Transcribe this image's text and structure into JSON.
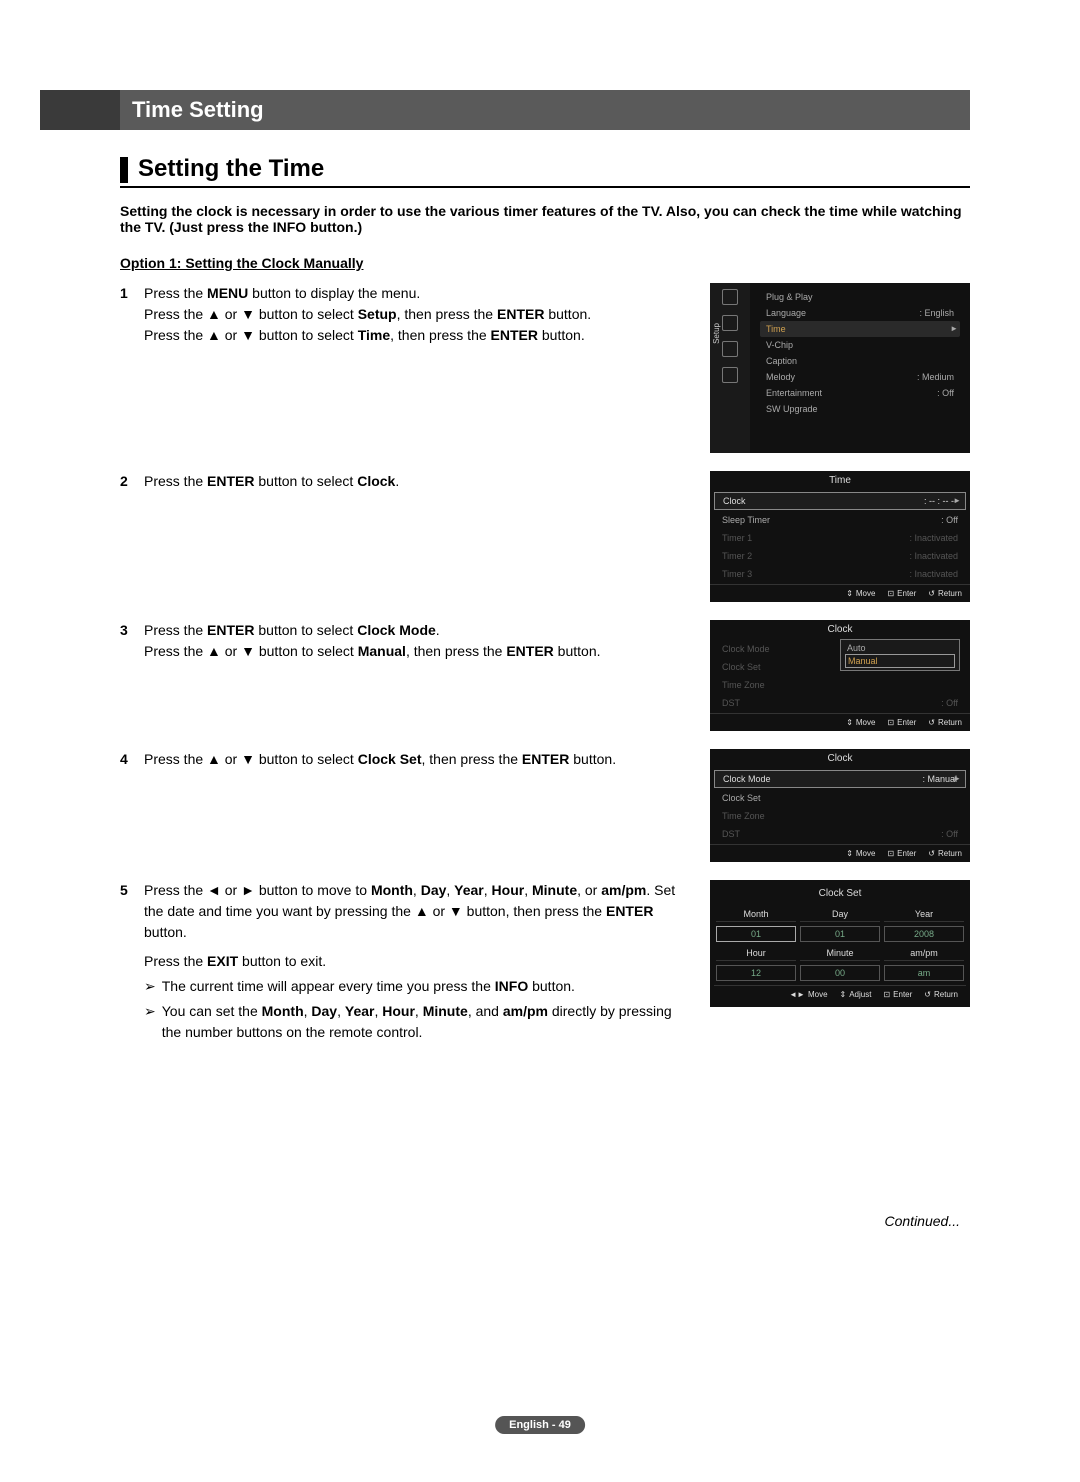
{
  "header": {
    "title": "Time Setting"
  },
  "title": "Setting the Time",
  "intro": "Setting the clock is necessary in order to use the various timer features of the TV. Also, you can check the time while watching the TV. (Just press the INFO button.)",
  "option_title": "Option 1: Setting the Clock Manually",
  "steps": [
    {
      "num": "1",
      "text": "Press the MENU button to display the menu.\nPress the ▲ or ▼ button to select Setup, then press the ENTER button.\nPress the ▲ or ▼ button to select Time, then press the ENTER button."
    },
    {
      "num": "2",
      "text": "Press the ENTER button to select Clock."
    },
    {
      "num": "3",
      "text": "Press the ENTER button to select Clock Mode.\nPress the ▲ or ▼ button to select Manual, then press the ENTER button."
    },
    {
      "num": "4",
      "text": "Press the ▲ or ▼ button to select Clock Set, then press the ENTER button."
    },
    {
      "num": "5",
      "text": "Press the ◄ or ► button to move to Month, Day, Year, Hour, Minute, or am/pm. Set the date and time you want by pressing the ▲ or ▼ button, then press the ENTER button.",
      "extra": "Press the EXIT button to exit.",
      "notes": [
        "The current time will appear every time you press the INFO button.",
        "You can set the Month, Day, Year, Hour, Minute, and am/pm directly by pressing the number buttons on the remote control."
      ]
    }
  ],
  "osd_setup": {
    "side_label": "Setup",
    "items": [
      {
        "label": "Plug & Play",
        "value": ""
      },
      {
        "label": "Language",
        "value": ": English"
      },
      {
        "label": "Time",
        "value": "",
        "hl": true
      },
      {
        "label": "V-Chip",
        "value": ""
      },
      {
        "label": "Caption",
        "value": ""
      },
      {
        "label": "Melody",
        "value": ": Medium"
      },
      {
        "label": "Entertainment",
        "value": ": Off"
      },
      {
        "label": "SW Upgrade",
        "value": ""
      }
    ]
  },
  "osd_time": {
    "title": "Time",
    "items": [
      {
        "label": "Clock",
        "value": ": -- : -- --",
        "sel": true
      },
      {
        "label": "Sleep Timer",
        "value": ": Off"
      },
      {
        "label": "Timer 1",
        "value": ": Inactivated",
        "dim": true
      },
      {
        "label": "Timer 2",
        "value": ": Inactivated",
        "dim": true
      },
      {
        "label": "Timer 3",
        "value": ": Inactivated",
        "dim": true
      }
    ],
    "foot": {
      "move": "Move",
      "enter": "Enter",
      "return": "Return"
    }
  },
  "osd_clock_popup": {
    "title": "Clock",
    "items": [
      {
        "label": "Clock Mode",
        "value": "",
        "dim": true
      },
      {
        "label": "Clock Set",
        "value": "",
        "dim": true
      },
      {
        "label": "Time Zone",
        "value": "",
        "dim": true
      },
      {
        "label": "DST",
        "value": ": Off",
        "dim": true
      }
    ],
    "popup": {
      "opts": [
        "Auto",
        "Manual"
      ],
      "sel": 1
    },
    "foot": {
      "move": "Move",
      "enter": "Enter",
      "return": "Return"
    }
  },
  "osd_clock_mode": {
    "title": "Clock",
    "items": [
      {
        "label": "Clock Mode",
        "value": ": Manual",
        "sel": true
      },
      {
        "label": "Clock Set",
        "value": ""
      },
      {
        "label": "Time Zone",
        "value": "",
        "dim": true
      },
      {
        "label": "DST",
        "value": ": Off",
        "dim": true
      }
    ],
    "foot": {
      "move": "Move",
      "enter": "Enter",
      "return": "Return"
    }
  },
  "osd_clockset": {
    "title": "Clock Set",
    "cols1": [
      "Month",
      "Day",
      "Year"
    ],
    "vals1": [
      "01",
      "01",
      "2008"
    ],
    "cols2": [
      "Hour",
      "Minute",
      "am/pm"
    ],
    "vals2": [
      "12",
      "00",
      "am"
    ],
    "foot": {
      "move": "Move",
      "adjust": "Adjust",
      "enter": "Enter",
      "return": "Return"
    }
  },
  "continued": "Continued...",
  "page_num": "English - 49"
}
